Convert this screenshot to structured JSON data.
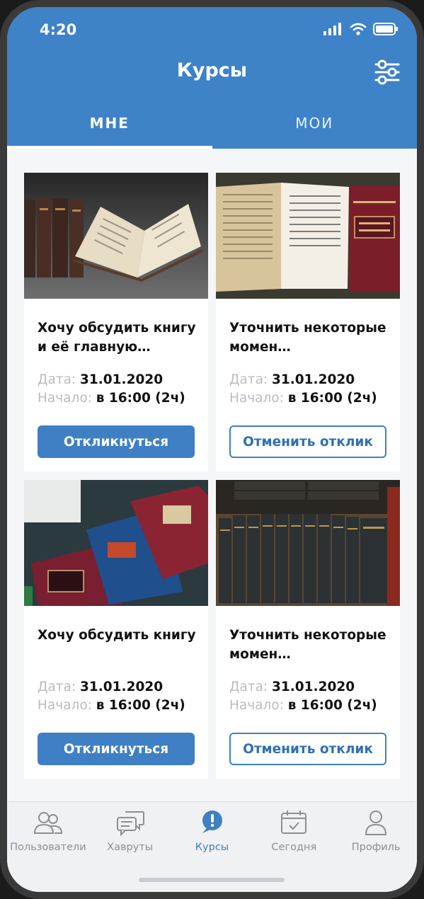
{
  "status": {
    "time": "4:20"
  },
  "header": {
    "title": "Курсы"
  },
  "tabs": [
    {
      "label": "МНЕ",
      "active": true
    },
    {
      "label": "МОИ",
      "active": false
    }
  ],
  "cards": [
    {
      "title": "Хочу обсудить книгу и её главную…",
      "date_label": "Дата:",
      "date": "31.01.2020",
      "start_label": "Начало:",
      "start": "в 16:00 (2ч)",
      "button": "Откликнуться"
    },
    {
      "title": "Уточнить некоторые момен…",
      "date_label": "Дата:",
      "date": "31.01.2020",
      "start_label": "Начало:",
      "start": "в 16:00 (2ч)",
      "button": "Отменить отклик"
    },
    {
      "title": "Хочу обсудить книгу",
      "date_label": "Дата:",
      "date": "31.01.2020",
      "start_label": "Начало:",
      "start": "в 16:00 (2ч)",
      "button": "Откликнуться"
    },
    {
      "title": "Уточнить некоторые момен…",
      "date_label": "Дата:",
      "date": "31.01.2020",
      "start_label": "Начало:",
      "start": "в 16:00 (2ч)",
      "button": "Отменить отклик"
    }
  ],
  "nav": [
    {
      "label": "Пользователи",
      "icon": "users-icon"
    },
    {
      "label": "Хавруты",
      "icon": "chat-bubbles-icon"
    },
    {
      "label": "Курсы",
      "icon": "courses-alert-icon",
      "active": true
    },
    {
      "label": "Сегодня",
      "icon": "calendar-check-icon"
    },
    {
      "label": "Профиль",
      "icon": "profile-icon"
    }
  ],
  "colors": {
    "accent": "#3e82c8",
    "button_primary": "#3f7fc4",
    "muted_text": "#b8bcc2",
    "nav_inactive": "#8b8f96"
  }
}
